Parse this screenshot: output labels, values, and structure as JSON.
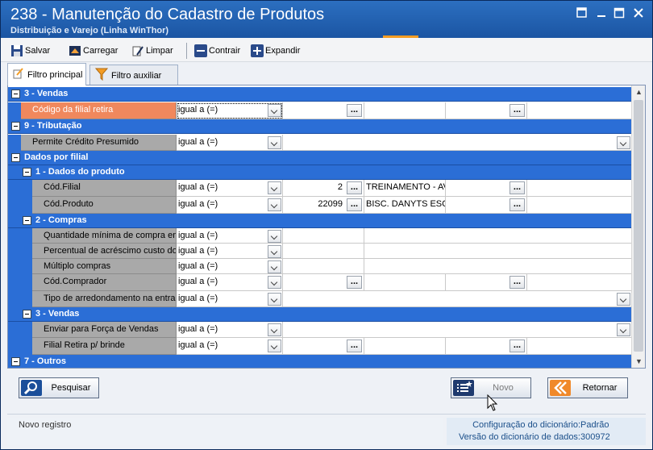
{
  "window": {
    "title": "238 - Manutenção do Cadastro de Produtos",
    "subtitle": "Distribuição e Varejo (Linha WinThor)"
  },
  "toolbar": {
    "salvar": "Salvar",
    "carregar": "Carregar",
    "limpar": "Limpar",
    "contrair": "Contrair",
    "expandir": "Expandir"
  },
  "tabs": {
    "principal": "Filtro principal",
    "auxiliar": "Filtro auxiliar"
  },
  "grid": {
    "sec_vendas_top": "3 - Vendas",
    "codigo_filial_retira": "Código da filial retira",
    "sec_tributacao": "9 - Tributação",
    "permite_credito": "Permite Crédito Presumido",
    "sec_dados_filial": "Dados por filial",
    "sec_dados_produto": "1 - Dados do produto",
    "cod_filial": "Cód.Filial",
    "cod_filial_value": "2",
    "cod_filial_desc": "TREINAMENTO - AV.",
    "cod_produto": "Cód.Produto",
    "cod_produto_value": "22099",
    "cod_produto_desc": "BISC. DANYTS ESCC",
    "sec_compras": "2 - Compras",
    "qtd_minima": "Quantidade mínima de compra em",
    "perc_acrescimo": "Percentual de acréscimo custo do",
    "multiplo_compras": "Múltiplo compras",
    "cod_comprador": "Cód.Comprador",
    "tipo_arredondamento": "Tipo de arredondamento na entra",
    "sec_vendas": "3 - Vendas",
    "enviar_forca": "Enviar para Força de Vendas",
    "filial_retira_brinde": "Filial Retira p/ brinde",
    "sec_outros": "7 - Outros",
    "operator": "igual a (=)",
    "ellipsis": "..."
  },
  "buttons": {
    "pesquisar": "Pesquisar",
    "novo": "Novo",
    "retornar": "Retornar"
  },
  "status": {
    "left": "Novo registro",
    "config_label": "Configuração do dicionário:",
    "config_value": "Padrão",
    "versao_label": "Versão do dicionário de dados:",
    "versao_value": "300972"
  },
  "colors": {
    "section_header": "#2b6ed6",
    "selected_label": "#f0885d",
    "label_bg": "#a9a9a9",
    "title_bar": "#1b55a3",
    "accent": "#f39c23"
  }
}
